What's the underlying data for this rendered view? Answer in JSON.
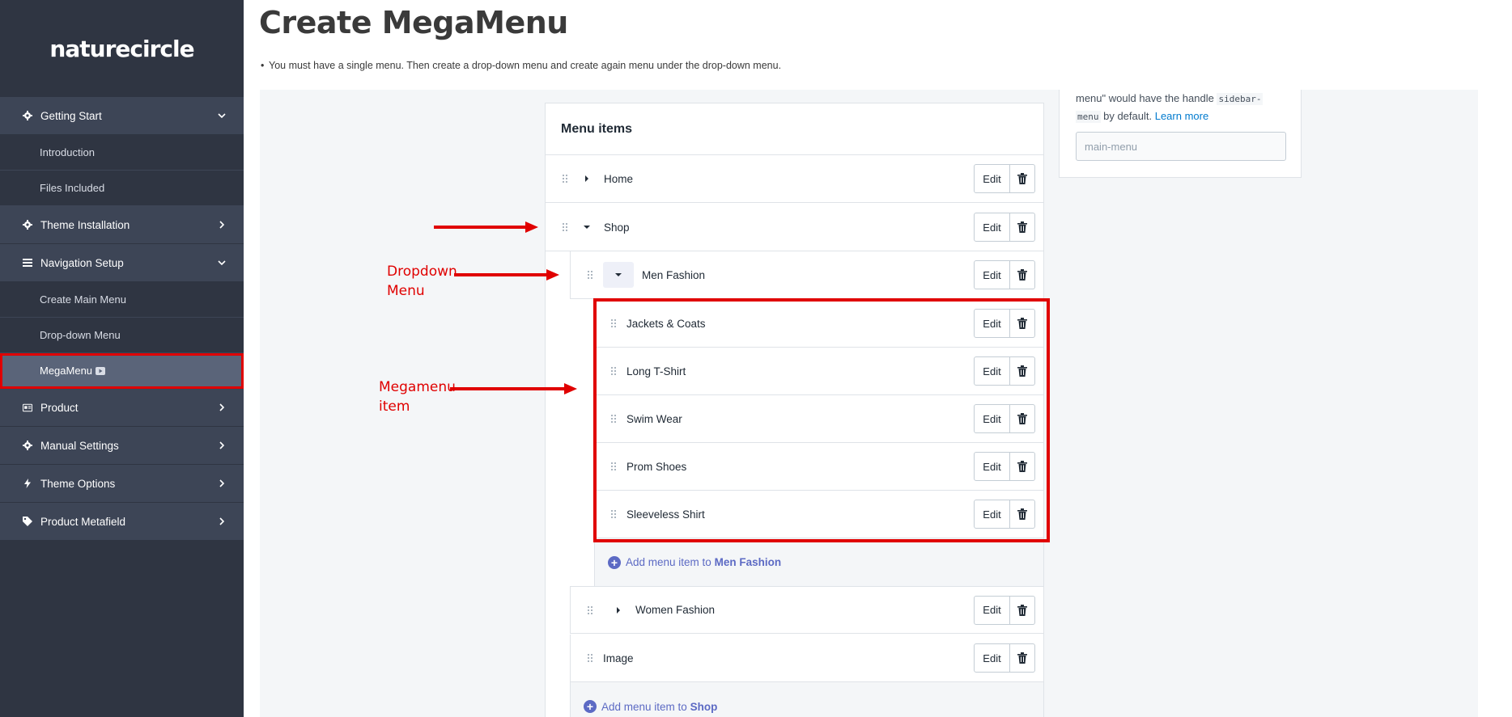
{
  "brand": {
    "name": "naturecircle"
  },
  "sidebar": {
    "items": [
      {
        "type": "section",
        "label": "Getting Start",
        "icon": "gear-icon",
        "chevron": "down"
      },
      {
        "type": "sub",
        "label": "Introduction"
      },
      {
        "type": "sub",
        "label": "Files Included"
      },
      {
        "type": "section",
        "label": "Theme Installation",
        "icon": "gear-icon",
        "chevron": "right"
      },
      {
        "type": "section",
        "label": "Navigation Setup",
        "icon": "bars-icon",
        "chevron": "down"
      },
      {
        "type": "sub",
        "label": "Create Main Menu"
      },
      {
        "type": "sub",
        "label": "Drop-down Menu"
      },
      {
        "type": "sub",
        "label": "MegaMenu",
        "active": true,
        "icon": "video-icon"
      },
      {
        "type": "section",
        "label": "Product",
        "icon": "card-icon",
        "chevron": "right"
      },
      {
        "type": "section",
        "label": "Manual Settings",
        "icon": "gear-icon",
        "chevron": "right"
      },
      {
        "type": "section",
        "label": "Theme Options",
        "icon": "bolt-icon",
        "chevron": "right"
      },
      {
        "type": "section",
        "label": "Product Metafield",
        "icon": "tag-icon",
        "chevron": "right"
      }
    ]
  },
  "main": {
    "title": "Create MegaMenu",
    "note": "You must have a single menu. Then create a drop-down menu and create again menu under the drop-down menu."
  },
  "menu_card": {
    "title": "Menu items",
    "edit_label": "Edit",
    "items": [
      {
        "label": "Home",
        "caret": "right"
      },
      {
        "label": "Shop",
        "caret": "down"
      },
      {
        "label": "Men Fashion",
        "caret": "down"
      },
      {
        "label": "Jackets & Coats"
      },
      {
        "label": "Long T-Shirt"
      },
      {
        "label": "Swim Wear"
      },
      {
        "label": "Prom Shoes"
      },
      {
        "label": "Sleeveless Shirt"
      },
      {
        "label": "Women Fashion",
        "caret": "right"
      },
      {
        "label": "Image"
      }
    ],
    "add_men": {
      "prefix": "Add menu item to ",
      "target": "Men Fashion"
    },
    "add_shop": {
      "prefix": "Add menu item to ",
      "target": "Shop"
    }
  },
  "right_panel": {
    "text_a": "menu\" would have the handle ",
    "code_a": "sidebar-",
    "code_b": "menu",
    "text_b": " by default. ",
    "link": "Learn more",
    "input_value": "main-menu"
  },
  "annotations": {
    "dropdown_line1": "Dropdown",
    "dropdown_line2": "Menu",
    "mega_line1": "Megamenu",
    "mega_line2": "item"
  },
  "colors": {
    "sidebar_bg": "#2f3542",
    "section_bg": "#3d4556",
    "accent": "#5c6ac4",
    "annotation": "#e00000"
  }
}
